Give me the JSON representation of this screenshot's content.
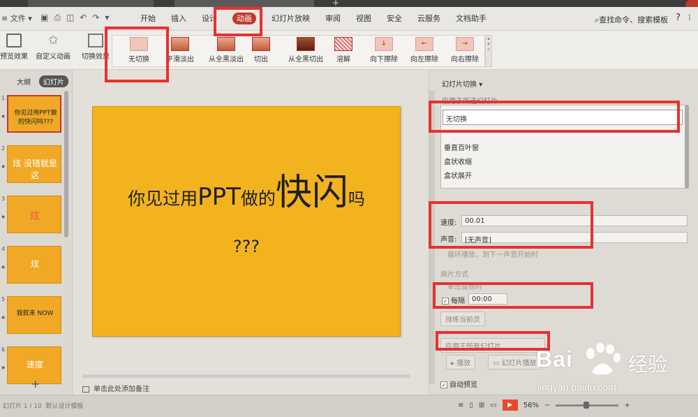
{
  "menubar": {
    "file_label": "≡ 文件 ▾",
    "tabs": [
      "开始",
      "插入",
      "设计",
      "动画",
      "幻灯片放映",
      "审阅",
      "视图",
      "安全",
      "云服务",
      "文档助手"
    ],
    "search_label": "查找命令、搜索模板",
    "help": "?"
  },
  "ribbon": {
    "preview": "预览效果",
    "custom_anim": "自定义动画",
    "switch_effect": "切换效果",
    "gallery": [
      "无切换",
      "平滑淡出",
      "从全黑淡出",
      "切出",
      "从全黑切出",
      "溶解",
      "向下擦除",
      "向左擦除",
      "向右擦除"
    ]
  },
  "leftpanel": {
    "tab_outline": "大纲",
    "tab_slides": "幻灯片",
    "thumbs": [
      {
        "num": "1",
        "text": "你见过用PPT做的快闪吗???"
      },
      {
        "num": "2",
        "text": "炫 没错就是这"
      },
      {
        "num": "3",
        "text": "炫"
      },
      {
        "num": "4",
        "text": "炫"
      },
      {
        "num": "5",
        "text": "我就来 NOW"
      },
      {
        "num": "6",
        "text": "速度"
      }
    ],
    "add": "+"
  },
  "slide": {
    "line1_a": "你见过用",
    "line1_b": "PPT",
    "line1_c": "做的",
    "line1_d": "快闪",
    "line1_e": "吗",
    "line2": "???",
    "notes": "单击此处添加备注"
  },
  "taskpane": {
    "title": "幻灯片切换 ▾",
    "apply_to": "应用于所选幻灯片",
    "list": [
      "无切换",
      "垂直百叶窗",
      "盒状收缩",
      "盒状展开"
    ],
    "speed_label": "速度:",
    "speed_value": "00.01",
    "sound_label": "声音:",
    "sound_value": "[无声音]",
    "loop_label": "循环播放，到下一声音开始时",
    "switch_mode": "换片方式",
    "on_click": "单击鼠标时",
    "every_label": "每隔",
    "every_value": "00:00",
    "rehearse": "排练当前页",
    "apply_all": "应用于所有幻灯片",
    "play": "播放",
    "slideshow": "幻灯片播放",
    "autopreview": "自动预览"
  },
  "statusbar": {
    "slide_info": "幻灯片 1 / 10",
    "theme": "默认设计模板",
    "zoom": "56%",
    "minus": "−",
    "plus": "+"
  },
  "watermark": {
    "bai": "Bai",
    "du_cn": "经验",
    "url": "jingyan.baidu.com"
  },
  "colors": {
    "accent_red": "#e8312f",
    "slide_bg": "#f2b31f",
    "active_tab": "#c0392b"
  }
}
